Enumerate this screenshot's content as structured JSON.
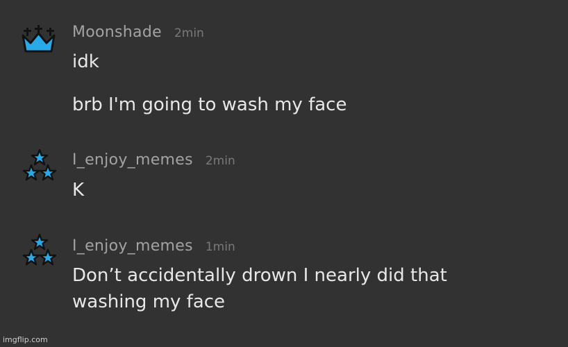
{
  "colors": {
    "background": "#323232",
    "username": "#a3a3a3",
    "timestamp": "#7a7a7a",
    "message_text": "#e8e8e8",
    "crown_accent": "#29a9e8",
    "star_accent": "#29a9e8"
  },
  "messages": [
    {
      "avatar_icon": "crown-icon",
      "username": "Moonshade",
      "timestamp": "2min",
      "lines": [
        "idk",
        "brb I'm going to wash my face"
      ]
    },
    {
      "avatar_icon": "three-stars-icon",
      "username": "I_enjoy_memes",
      "timestamp": "2min",
      "lines": [
        "K"
      ]
    },
    {
      "avatar_icon": "three-stars-icon",
      "username": "I_enjoy_memes",
      "timestamp": "1min",
      "lines": [
        "Don’t accidentally drown I nearly did that washing my face"
      ]
    }
  ],
  "watermark": "imgflip.com"
}
